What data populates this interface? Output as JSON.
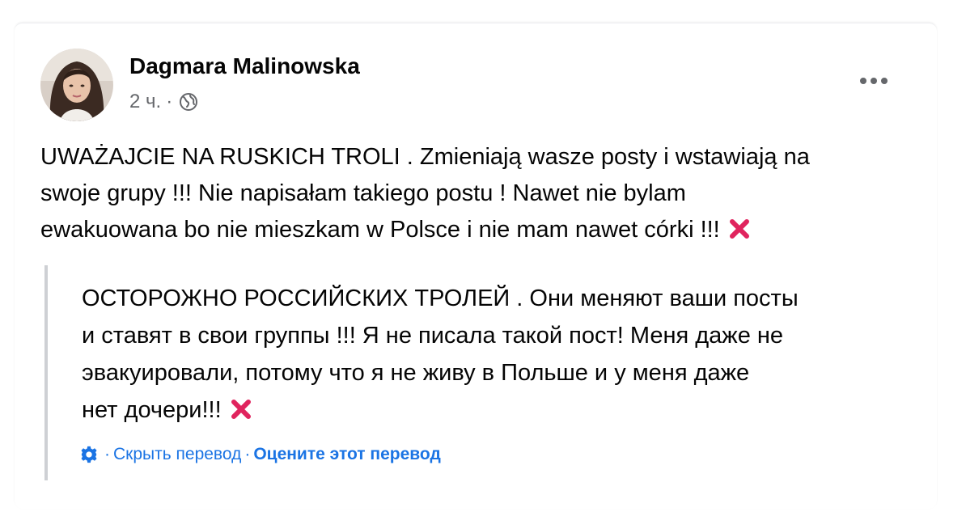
{
  "post": {
    "author": "Dagmara Malinowska",
    "time": "2 ч.",
    "meta_sep": "·",
    "privacy_icon": "globe-icon",
    "more_icon": "ellipsis-icon",
    "text_lines": [
      "UWAŻAJCIE NA RUSKICH TROLI . Zmieniają wasze posty i wstawiają na",
      "swoje grupy !!! Nie napisałam takiego postu ! Nawet nie bylam",
      "ewakuowana bo nie mieszkam w Polsce i nie mam nawet córki !!!"
    ],
    "emoji": "cross-mark-emoji"
  },
  "translation": {
    "text_lines": [
      "ОСТОРОЖНО РОССИЙСКИХ ТРОЛЕЙ . Они меняют ваши посты",
      "и ставят в свои группы !!! Я не писала такой пост! Меня даже не",
      "эвакуировали, потому что я не живу в Польше и у меня даже",
      "нет дочери!!!"
    ],
    "emoji": "cross-mark-emoji",
    "settings_icon": "gear-icon",
    "sep": "·",
    "hide_label": "Скрыть перевод",
    "rate_label": "Оцените этот перевод"
  },
  "colors": {
    "link_blue": "#1b74e4",
    "secondary_text": "#65676b",
    "emoji_red": "#e0245e",
    "quote_bar": "#ced0d4"
  }
}
